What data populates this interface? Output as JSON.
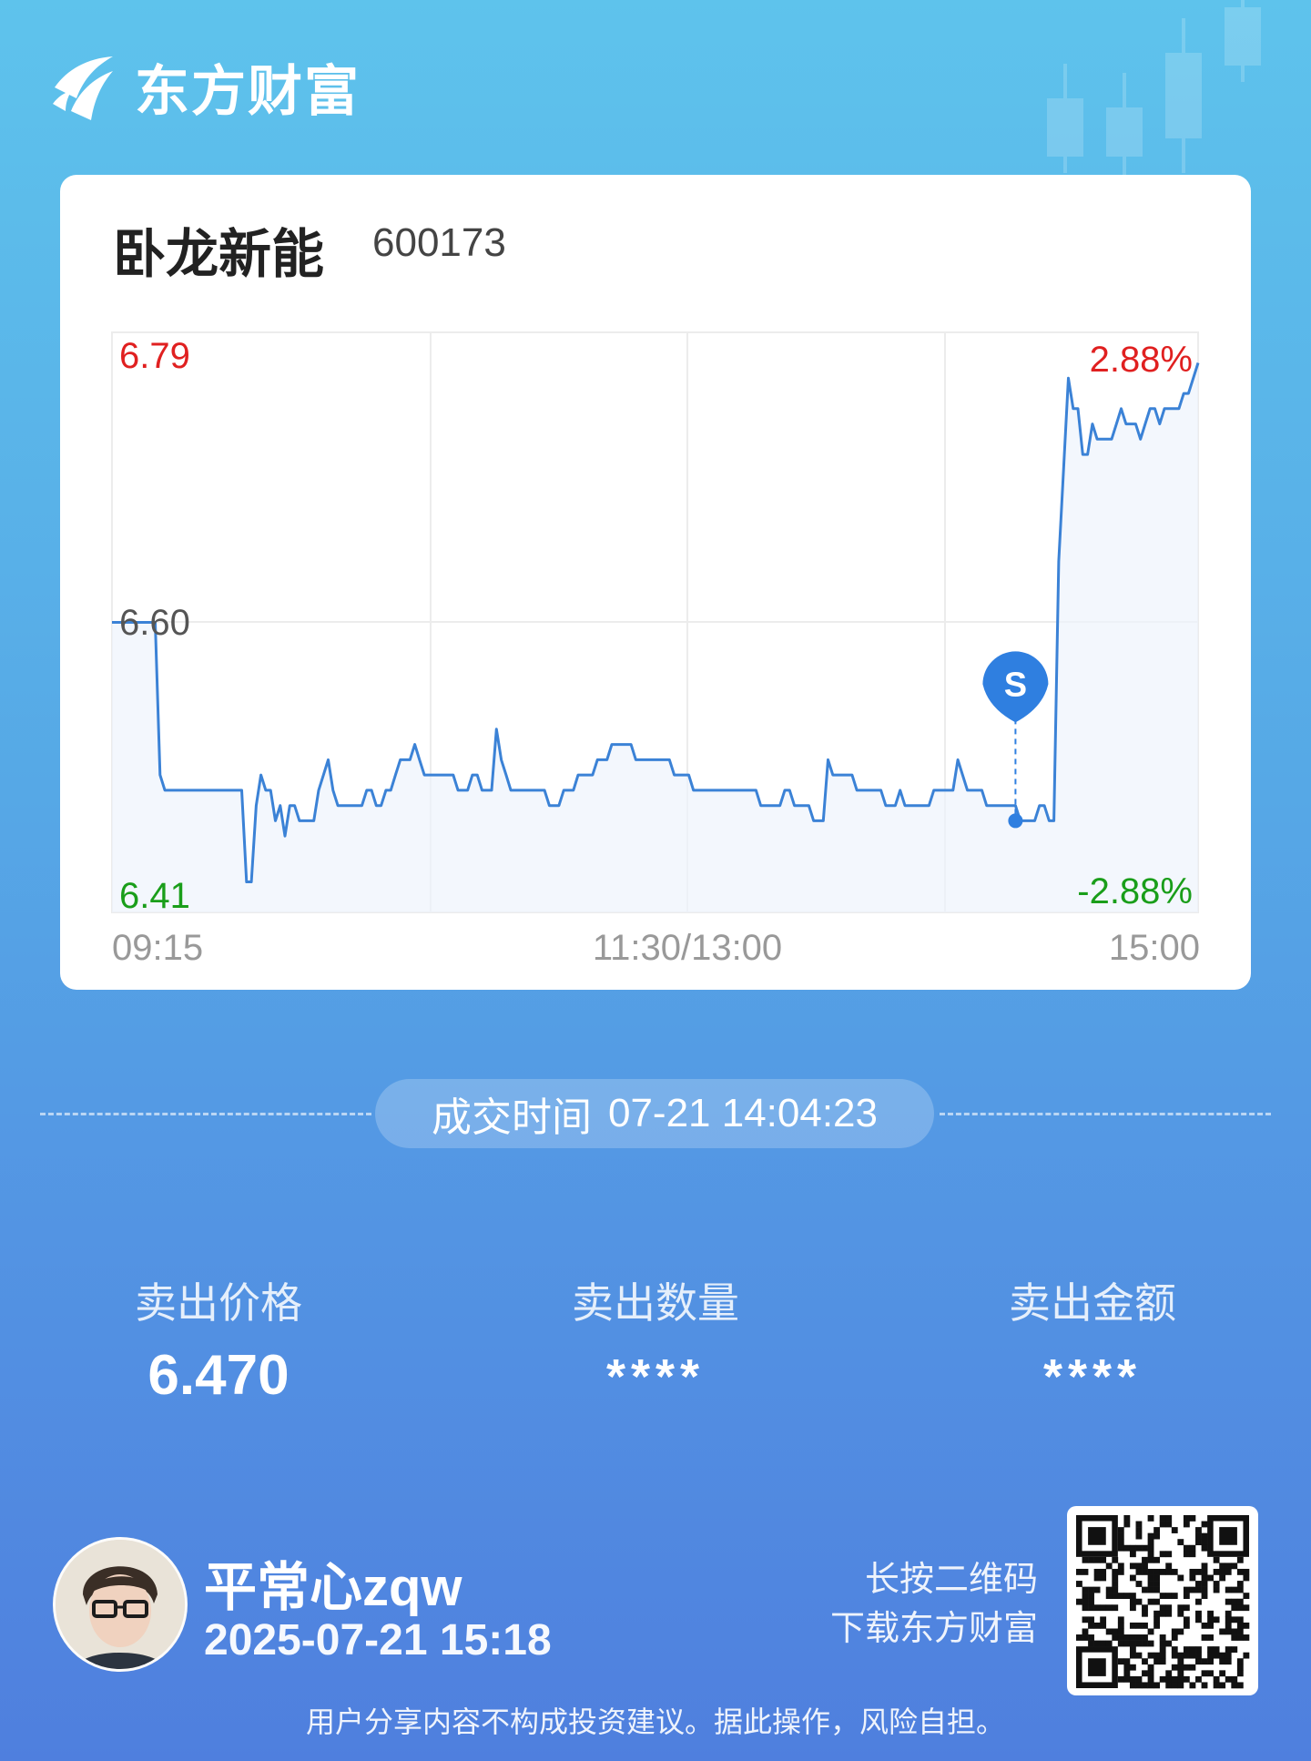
{
  "brand": {
    "name": "东方财富"
  },
  "stock": {
    "name": "卧龙新能",
    "code": "600173"
  },
  "chart_data": {
    "type": "line",
    "y_axis_left": {
      "max": "6.79",
      "mid": "6.60",
      "min": "6.41"
    },
    "y_axis_right": {
      "max": "2.88%",
      "min": "-2.88%"
    },
    "x_axis": {
      "start": "09:15",
      "mid": "11:30/13:00",
      "end": "15:00"
    },
    "ylim": [
      6.41,
      6.79
    ],
    "prev_close": 6.6,
    "marker": {
      "label": "S",
      "time_index": 188,
      "price": 6.47
    },
    "series": [
      {
        "values": [
          6.6,
          6.6,
          6.6,
          6.6,
          6.6,
          6.6,
          6.6,
          6.6,
          6.6,
          6.6,
          6.5,
          6.49,
          6.49,
          6.49,
          6.49,
          6.49,
          6.49,
          6.49,
          6.49,
          6.49,
          6.49,
          6.49,
          6.49,
          6.49,
          6.49,
          6.49,
          6.49,
          6.49,
          6.43,
          6.43,
          6.48,
          6.5,
          6.49,
          6.49,
          6.47,
          6.48,
          6.46,
          6.48,
          6.48,
          6.47,
          6.47,
          6.47,
          6.47,
          6.49,
          6.5,
          6.51,
          6.49,
          6.48,
          6.48,
          6.48,
          6.48,
          6.48,
          6.48,
          6.49,
          6.49,
          6.48,
          6.48,
          6.49,
          6.49,
          6.5,
          6.51,
          6.51,
          6.51,
          6.52,
          6.51,
          6.5,
          6.5,
          6.5,
          6.5,
          6.5,
          6.5,
          6.5,
          6.49,
          6.49,
          6.49,
          6.5,
          6.5,
          6.49,
          6.49,
          6.49,
          6.53,
          6.51,
          6.5,
          6.49,
          6.49,
          6.49,
          6.49,
          6.49,
          6.49,
          6.49,
          6.49,
          6.48,
          6.48,
          6.48,
          6.49,
          6.49,
          6.49,
          6.5,
          6.5,
          6.5,
          6.5,
          6.51,
          6.51,
          6.51,
          6.52,
          6.52,
          6.52,
          6.52,
          6.52,
          6.51,
          6.51,
          6.51,
          6.51,
          6.51,
          6.51,
          6.51,
          6.51,
          6.5,
          6.5,
          6.5,
          6.5,
          6.49,
          6.49,
          6.49,
          6.49,
          6.49,
          6.49,
          6.49,
          6.49,
          6.49,
          6.49,
          6.49,
          6.49,
          6.49,
          6.49,
          6.48,
          6.48,
          6.48,
          6.48,
          6.48,
          6.49,
          6.49,
          6.48,
          6.48,
          6.48,
          6.48,
          6.47,
          6.47,
          6.47,
          6.51,
          6.5,
          6.5,
          6.5,
          6.5,
          6.5,
          6.49,
          6.49,
          6.49,
          6.49,
          6.49,
          6.49,
          6.48,
          6.48,
          6.48,
          6.49,
          6.48,
          6.48,
          6.48,
          6.48,
          6.48,
          6.48,
          6.49,
          6.49,
          6.49,
          6.49,
          6.49,
          6.51,
          6.5,
          6.49,
          6.49,
          6.49,
          6.49,
          6.48,
          6.48,
          6.48,
          6.48,
          6.48,
          6.48,
          6.48,
          6.47,
          6.47,
          6.47,
          6.47,
          6.48,
          6.48,
          6.47,
          6.47,
          6.64,
          6.7,
          6.76,
          6.74,
          6.74,
          6.71,
          6.71,
          6.73,
          6.72,
          6.72,
          6.72,
          6.72,
          6.73,
          6.74,
          6.73,
          6.73,
          6.73,
          6.72,
          6.73,
          6.74,
          6.74,
          6.73,
          6.74,
          6.74,
          6.74,
          6.74,
          6.75,
          6.75,
          6.76,
          6.77
        ]
      }
    ]
  },
  "trade": {
    "label": "成交时间",
    "time": "07-21 14:04:23"
  },
  "stats": [
    {
      "label": "卖出价格",
      "value": "6.470"
    },
    {
      "label": "卖出数量",
      "value": "****"
    },
    {
      "label": "卖出金额",
      "value": "****"
    }
  ],
  "user": {
    "name": "平常心zqw",
    "post_time": "2025-07-21 15:18"
  },
  "qr": {
    "hint_line1": "长按二维码",
    "hint_line2": "下载东方财富"
  },
  "disclaimer": "用户分享内容不构成投资建议。据此操作，风险自担。",
  "colors": {
    "up": "#e02020",
    "down": "#1a9e1a",
    "line": "#3b82d6",
    "marker": "#2f7fe0"
  }
}
